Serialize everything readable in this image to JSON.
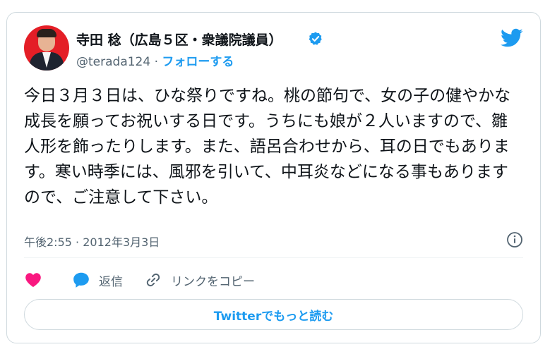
{
  "tweet": {
    "author_name": "寺田 稔（広島５区・衆議院議員）",
    "handle": "@terada124",
    "separator": "·",
    "follow_label": "フォローする",
    "text": "今日３月３日は、ひな祭りですね。桃の節句で、女の子の健やかな成長を願ってお祝いする日です。うちにも娘が２人いますので、雛人形を飾ったりします。また、語呂合わせから、耳の日でもあります。寒い時季には、風邪を引いて、中耳炎などになる事もありますので、ご注意して下さい。",
    "time": "午後2:55",
    "date": "2012年3月3日"
  },
  "actions": {
    "like_icon": "heart-icon",
    "reply_label": "返信",
    "copy_link_label": "リンクをコピー"
  },
  "footer": {
    "read_more_label": "Twitterでもっと読む"
  },
  "colors": {
    "accent": "#1d9bf0",
    "like": "#f91880",
    "text": "#0f1419",
    "muted": "#536471",
    "border": "#cfd9de"
  }
}
